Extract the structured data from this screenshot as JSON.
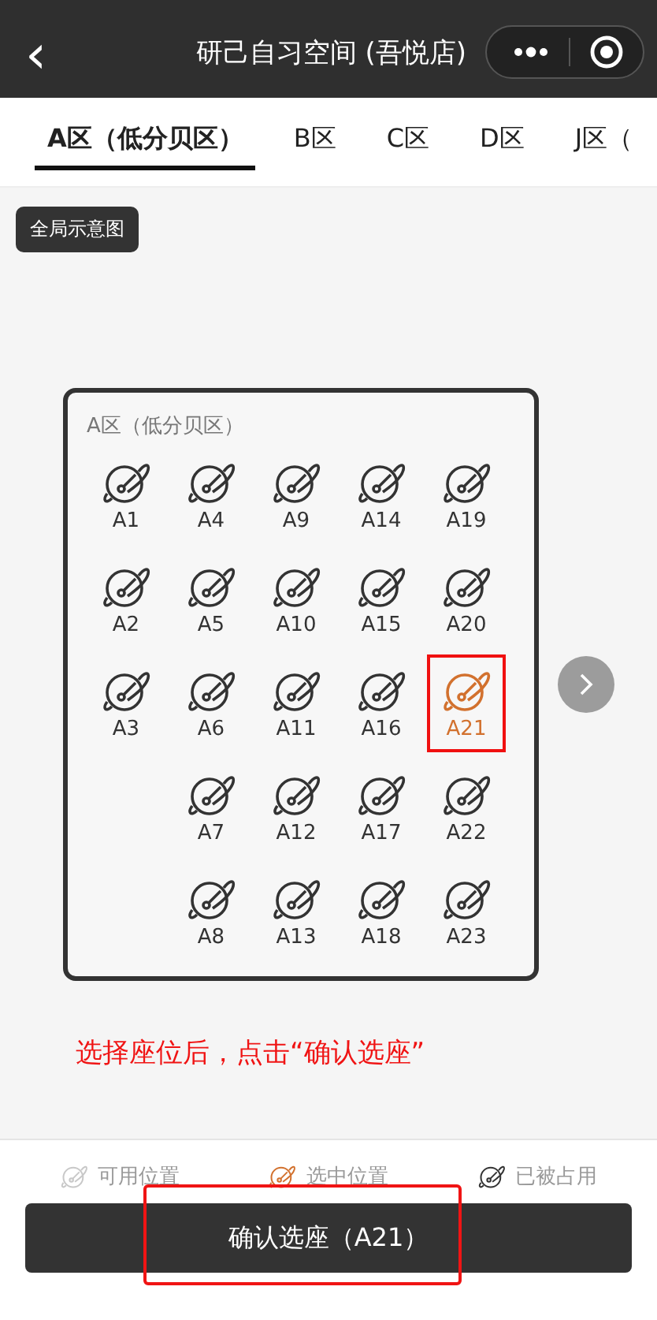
{
  "header": {
    "title": "研己自习空间 (吾悦店)",
    "back": "‹"
  },
  "tabs": [
    {
      "label": "A区（低分贝区）",
      "selected": true
    },
    {
      "label": "B区",
      "selected": false
    },
    {
      "label": "C区",
      "selected": false
    },
    {
      "label": "D区",
      "selected": false
    },
    {
      "label": "J区（",
      "selected": false
    }
  ],
  "overview_button": "全局示意图",
  "seat_map": {
    "title": "A区（低分贝区）",
    "columns": [
      [
        {
          "label": "A1",
          "kind": "occupied"
        },
        {
          "label": "A2",
          "kind": "occupied"
        },
        {
          "label": "A3",
          "kind": "occupied"
        }
      ],
      [
        {
          "label": "A4",
          "kind": "occupied"
        },
        {
          "label": "A5",
          "kind": "occupied"
        },
        {
          "label": "A6",
          "kind": "occupied"
        },
        {
          "label": "A7",
          "kind": "occupied"
        },
        {
          "label": "A8",
          "kind": "occupied"
        }
      ],
      [
        {
          "label": "A9",
          "kind": "occupied"
        },
        {
          "label": "A10",
          "kind": "occupied"
        },
        {
          "label": "A11",
          "kind": "occupied"
        },
        {
          "label": "A12",
          "kind": "occupied"
        },
        {
          "label": "A13",
          "kind": "occupied"
        }
      ],
      [
        {
          "label": "A14",
          "kind": "occupied"
        },
        {
          "label": "A15",
          "kind": "occupied"
        },
        {
          "label": "A16",
          "kind": "occupied"
        },
        {
          "label": "A17",
          "kind": "occupied"
        },
        {
          "label": "A18",
          "kind": "occupied"
        }
      ],
      [
        {
          "label": "A19",
          "kind": "occupied"
        },
        {
          "label": "A20",
          "kind": "occupied"
        },
        {
          "label": "A21",
          "kind": "selected"
        },
        {
          "label": "A22",
          "kind": "occupied"
        },
        {
          "label": "A23",
          "kind": "occupied"
        }
      ]
    ]
  },
  "instruction": "选择座位后，点击“确认选座”",
  "legend": [
    {
      "kind": "available",
      "label": "可用位置"
    },
    {
      "kind": "selected",
      "label": "选中位置"
    },
    {
      "kind": "occupied",
      "label": "已被占用"
    }
  ],
  "confirm_button": {
    "label": "确认选座（A21）",
    "annotated": true
  }
}
